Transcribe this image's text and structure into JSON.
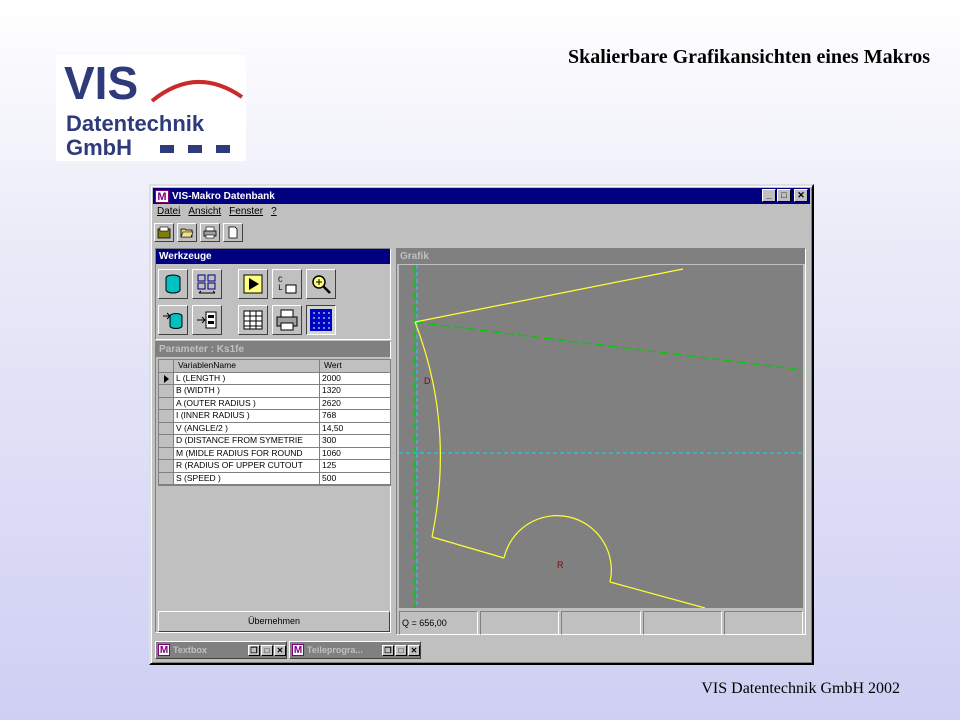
{
  "slide": {
    "title": "Skalierbare Grafikansichten eines Makros",
    "footer": "VIS Datentechnik GmbH 2002"
  },
  "logo": {
    "line1": "VIS",
    "line2": "Datentechnik",
    "line3": "GmbH"
  },
  "colors": {
    "brand_blue": "#2e3a7a",
    "brand_red": "#cc2a2a",
    "titlebar": "#000080",
    "canvas_bg": "#808080",
    "curve_yellow": "#ffff33",
    "axis_green": "#00cc00",
    "axis_cyan": "#00e0ff",
    "label_red": "#8b0000"
  },
  "window": {
    "title": "VIS-Makro Datenbank",
    "app_icon_letter": "M",
    "controls": [
      "_",
      "□",
      "✕"
    ],
    "menu": [
      "Datei",
      "Ansicht",
      "Fenster",
      "?"
    ],
    "toolbar_icons": [
      "database-icon",
      "open-folder-icon",
      "print-icon",
      "new-document-icon"
    ]
  },
  "werkzeuge": {
    "title": "Werkzeuge",
    "row1": [
      "database-icon",
      "grid-arrows-icon",
      "play-icon",
      "code-icon",
      "zoom-icon"
    ],
    "row2": [
      "import-database-icon",
      "export-table-icon",
      "table-icon",
      "printer-icon",
      "dots-grid-icon"
    ]
  },
  "parameter": {
    "title": "Parameter : Ks1fe",
    "headers": [
      "VariablenName",
      "Wert"
    ],
    "rows": [
      {
        "name": "L    (LENGTH )",
        "value": "2000"
      },
      {
        "name": "B    (WIDTH )",
        "value": "1320"
      },
      {
        "name": "A    (OUTER RADIUS )",
        "value": "2620"
      },
      {
        "name": "I    (INNER RADIUS )",
        "value": "768"
      },
      {
        "name": "V    (ANGLE/2 )",
        "value": "14,50"
      },
      {
        "name": "D    (DISTANCE FROM SYMETRIE",
        "value": "300"
      },
      {
        "name": "M    (MIDLE RADIUS FOR ROUND",
        "value": "1060"
      },
      {
        "name": "R    (RADIUS OF UPPER CUTOUT",
        "value": "125"
      },
      {
        "name": "S    (SPEED )",
        "value": "500"
      }
    ],
    "apply_button": "Übernehmen"
  },
  "grafik": {
    "title": "Grafik",
    "labels": {
      "d": "D",
      "r": "R"
    },
    "status": [
      "Q = 656,00",
      "",
      "",
      "",
      ""
    ]
  },
  "mdi_windows": [
    {
      "label": "Textbox"
    },
    {
      "label": "Teileprogra..."
    }
  ]
}
